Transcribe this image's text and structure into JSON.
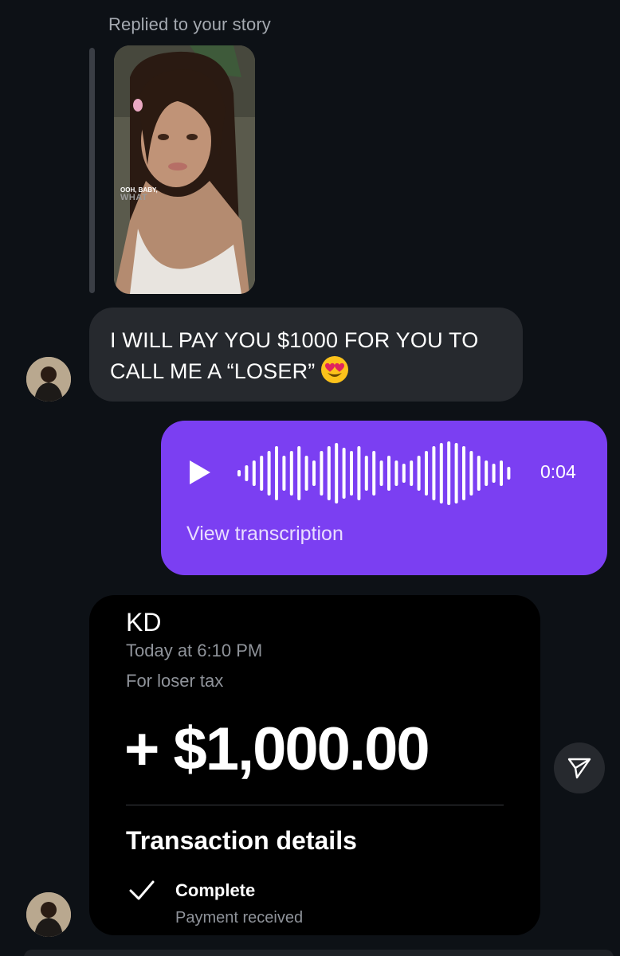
{
  "reply": {
    "label": "Replied to your story"
  },
  "story": {
    "caption_line1": "OOH, BABY,",
    "caption_line2": "WHAT"
  },
  "incoming_message": {
    "text": "I WILL PAY YOU $1000 FOR YOU TO CALL ME A “LOSER”",
    "emoji": "smiling-face-with-heart-eyes"
  },
  "voice_message": {
    "duration": "0:04",
    "transcription_link": "View transcription",
    "color": "#7b3ff2",
    "waveform_levels": [
      0.1,
      0.25,
      0.4,
      0.55,
      0.7,
      0.85,
      0.55,
      0.7,
      0.85,
      0.55,
      0.4,
      0.7,
      0.85,
      0.95,
      0.8,
      0.7,
      0.85,
      0.55,
      0.7,
      0.4,
      0.55,
      0.4,
      0.3,
      0.4,
      0.55,
      0.7,
      0.85,
      0.95,
      1.0,
      0.95,
      0.85,
      0.7,
      0.55,
      0.4,
      0.3,
      0.4,
      0.2
    ]
  },
  "payment": {
    "sender": "KD",
    "time": "Today at 6:10 PM",
    "note": "For loser tax",
    "amount": "+ $1,000.00",
    "details_title": "Transaction details",
    "status": "Complete",
    "status_sub": "Payment received"
  },
  "colors": {
    "background": "#0d1116",
    "incoming_bubble": "#26292e",
    "card": "#000000"
  }
}
